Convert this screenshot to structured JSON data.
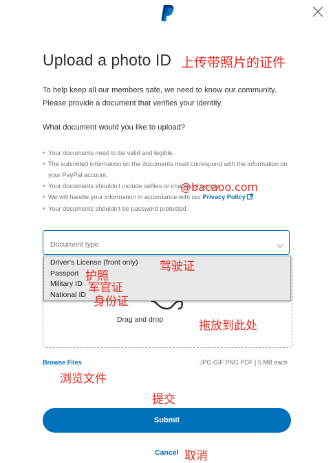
{
  "header": {
    "logo_icon": "paypal-logo-icon",
    "close_icon": "close-icon"
  },
  "page": {
    "title": "Upload a photo ID",
    "title_annotation": "上传带照片的证件",
    "intro": "To help keep all our members safe, we need to know our community. Please provide a document that verifies your identity.",
    "question": "What document would you like to upload?"
  },
  "rules": [
    {
      "text": "Your documents need to be valid and legible."
    },
    {
      "text": "The submitted information on the documents must correspond with the information on your PayPal account."
    },
    {
      "text": "Your documents shouldn't include selfies or images of people."
    },
    {
      "text_before": "We will handle your information in accordance with our ",
      "link": "Privacy Policy",
      "text_after": "."
    },
    {
      "text": "Your documents shouldn't be password protected."
    }
  ],
  "watermark": "@bacaoo.com",
  "form": {
    "select_label": "Document type",
    "options": [
      {
        "label": "Driver's License (front only)",
        "annotation": "驾驶证"
      },
      {
        "label": "Passport",
        "annotation": "护照"
      },
      {
        "label": "Military ID",
        "annotation": "军官证"
      },
      {
        "label": "National ID",
        "annotation": "身份证"
      }
    ],
    "drag_text": "Drag and drop",
    "drag_annotation": "拖放到此处",
    "browse_label": "Browse Files",
    "browse_annotation": "浏览文件",
    "formats": "JPG GIF PNG PDF | 5 MB each"
  },
  "actions": {
    "submit_label": "Submit",
    "submit_annotation": "提交",
    "cancel_label": "Cancel",
    "cancel_annotation": "取消"
  },
  "colors": {
    "brand_blue": "#0070ba",
    "annotation_red": "#e8281f",
    "text_primary": "#2c2e2f",
    "text_secondary": "#6c7378"
  }
}
